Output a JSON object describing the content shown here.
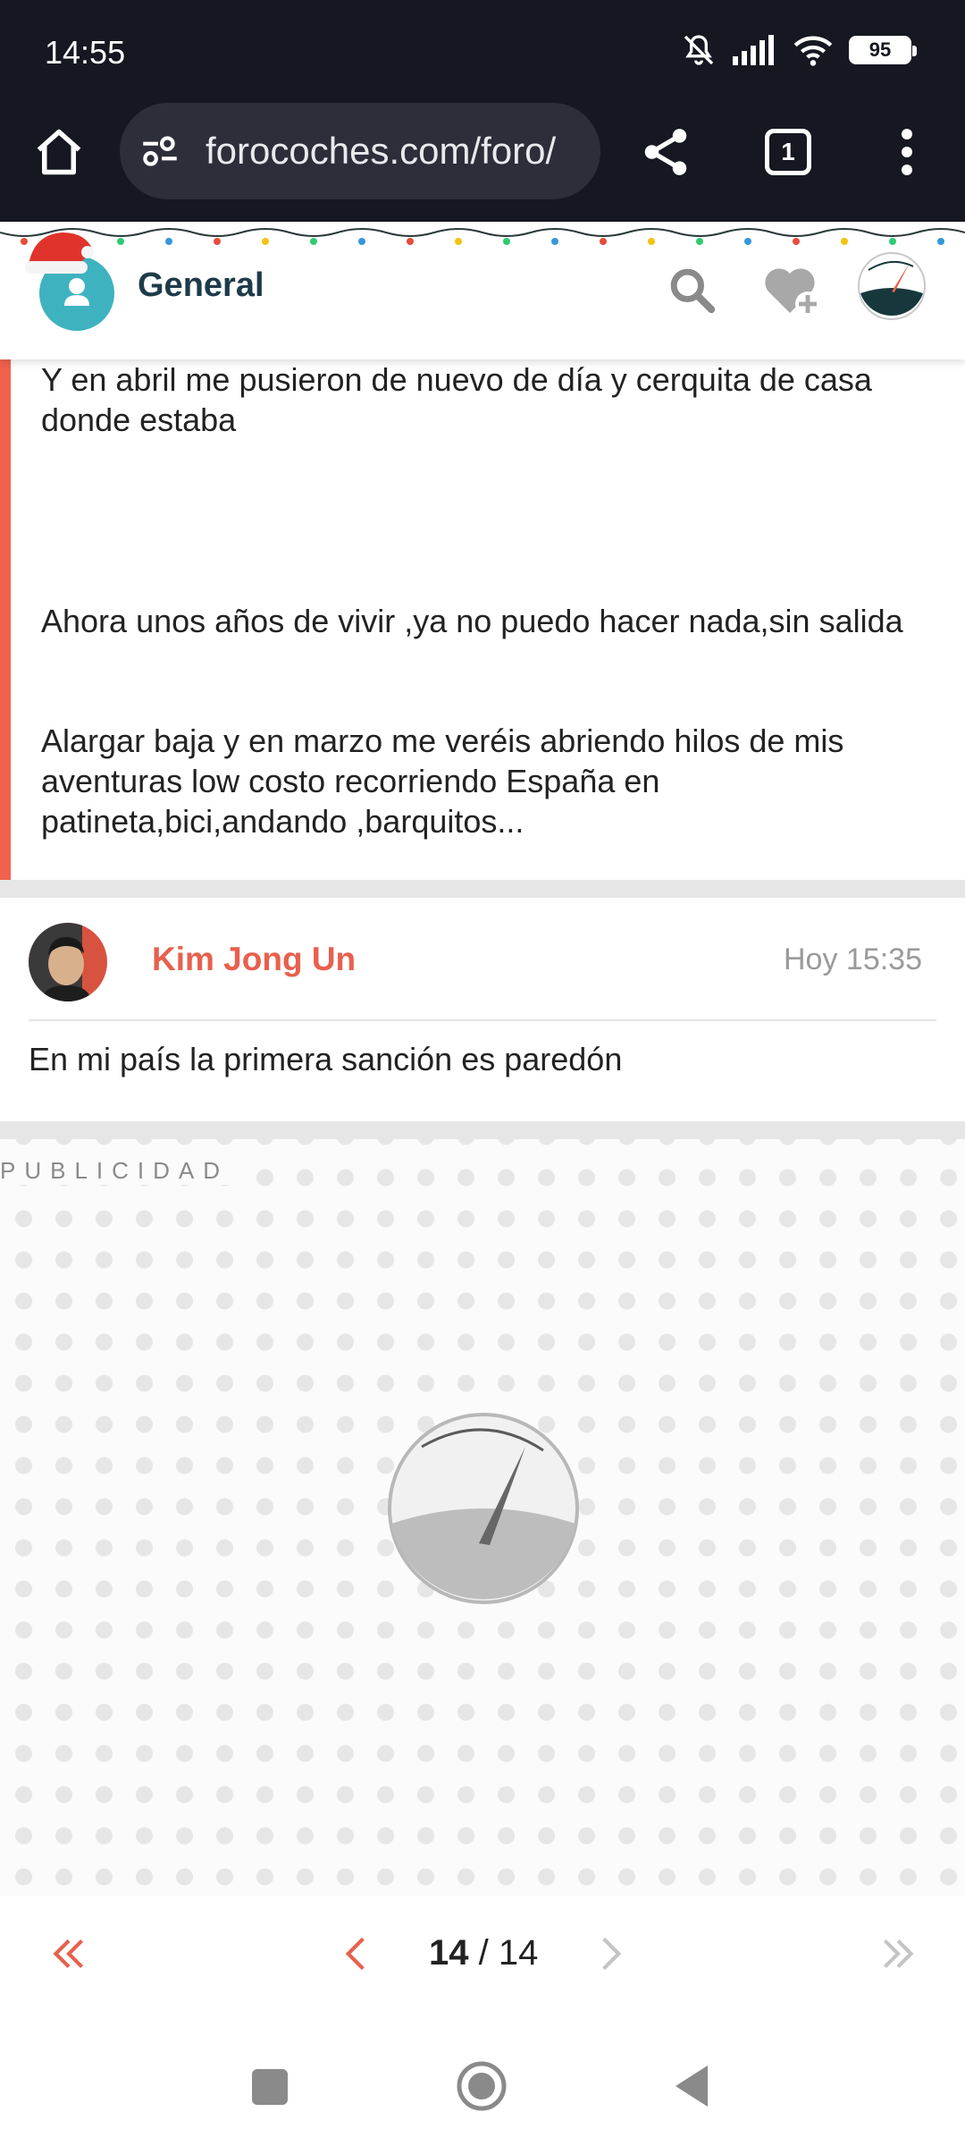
{
  "status_bar": {
    "time": "14:55",
    "battery": "95"
  },
  "browser": {
    "url": "forocoches.com/foro/",
    "tab_count": "1"
  },
  "forum": {
    "title": "General"
  },
  "post1": {
    "paragraphs": [
      "Y en abril me pusieron de nuevo de día y cerquita de casa donde estaba",
      "Ahora unos años de vivir ,ya no puedo hacer nada,sin salida",
      "Alargar baja y en marzo me veréis abriendo hilos de mis aventuras low costo recorriendo España en patineta,bici,andando ,barquitos..."
    ]
  },
  "post2": {
    "author": "Kim Jong Un",
    "time": "Hoy 15:35",
    "body": "En mi país la primera sanción es paredón"
  },
  "ad": {
    "label": "PUBLICIDAD"
  },
  "pagination": {
    "current": "14",
    "separator": " / ",
    "total": "14"
  },
  "colors": {
    "accent": "#e8604d",
    "dark": "#151821",
    "forum_icon": "#3fb2c0"
  }
}
